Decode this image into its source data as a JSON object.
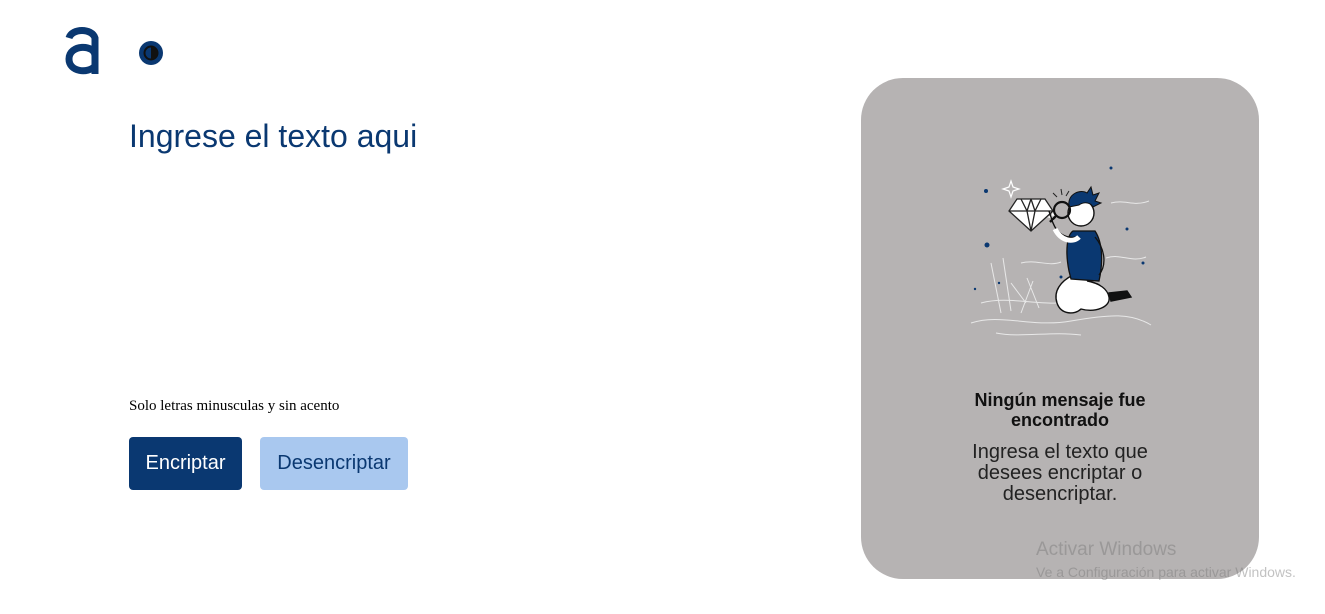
{
  "header": {
    "logo_icon": "alura-a-logo-icon",
    "theme_toggle_icon": "contrast-toggle-icon"
  },
  "input": {
    "placeholder": "Ingrese el texto aqui",
    "value": ""
  },
  "hint": {
    "text": "Solo letras minusculas y sin acento",
    "icon": ""
  },
  "buttons": {
    "encrypt_label": "Encriptar",
    "decrypt_label": "Desencriptar"
  },
  "output_panel": {
    "illustration_icon": "person-with-magnifier-illustration",
    "title": "Ningún mensaje fue encontrado",
    "text": "Ingresa el texto que desees encriptar o desencriptar."
  },
  "os_watermark": {
    "title": "Activar Windows",
    "subtitle": "Ve a Configuración para activar Windows."
  },
  "colors": {
    "primary": "#0a3871",
    "secondary_button": "#a9c8ef",
    "panel_bg": "#b6b3b3",
    "page_bg": "#ffffff"
  }
}
